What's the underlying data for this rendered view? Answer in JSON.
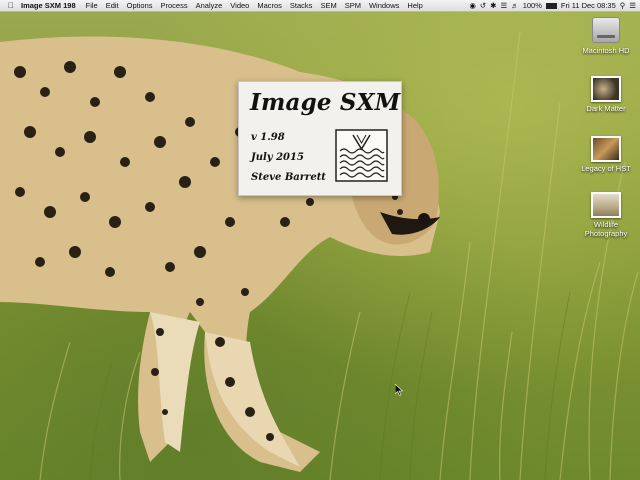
{
  "menubar": {
    "app_name": "Image SXM 198",
    "menus": [
      "File",
      "Edit",
      "Options",
      "Process",
      "Analyze",
      "Video",
      "Macros",
      "Stacks",
      "SEM",
      "SPM",
      "Windows",
      "Help"
    ],
    "battery": "100%",
    "datetime": "Fri 11 Dec 08:35"
  },
  "splash": {
    "title": "Image SXM",
    "version": "v 1.98",
    "date": "July 2015",
    "author": "Steve Barrett"
  },
  "desktop_icons": [
    {
      "label": "Macintosh HD"
    },
    {
      "label": "Dark Matter"
    },
    {
      "label": "Legacy of HST"
    },
    {
      "label": "Wildlife Photography"
    }
  ]
}
